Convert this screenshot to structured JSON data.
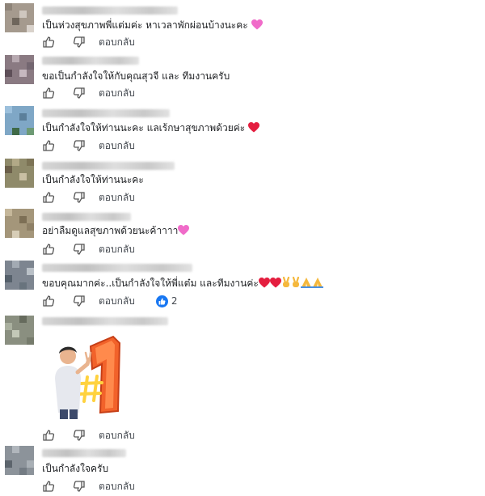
{
  "reply_label": "ตอบกลับ",
  "comments": [
    {
      "text": "เป็นห่วงสุขภาพพี่แต่มค่ะ หาเวลาพักผ่อนบ้างนะคะ"
    },
    {
      "text": "ขอเป็นกำลังใจให้กับคุณสุวจี และ ทีมงานครับ"
    },
    {
      "text": "เป็นกำลังใจให้ท่านนะคะ แลเร้กษาสุขภาพด้วยค่ะ"
    },
    {
      "text": "เป็นกำลังใจให้ท่านนะคะ"
    },
    {
      "text": "อย่าลืมดูแลสุขภาพด้วยนะค้าาาา"
    },
    {
      "text": "ขอบคุณมากค่ะ..เป็นกำลังใจให้พี่แต๋ม และทีมงานค่ะ",
      "reaction_count": "2"
    },
    {
      "sticker": "number-one-sticker"
    },
    {
      "text": "เป็นกำลังใจครับ"
    }
  ],
  "colors": {
    "text": "#1c1e21",
    "secondary": "#444950",
    "like_blue": "#1877f2",
    "heart_red": "#e41e3f",
    "heart_pink": "#f06bc9",
    "sticker_orange": "#f2622a"
  }
}
